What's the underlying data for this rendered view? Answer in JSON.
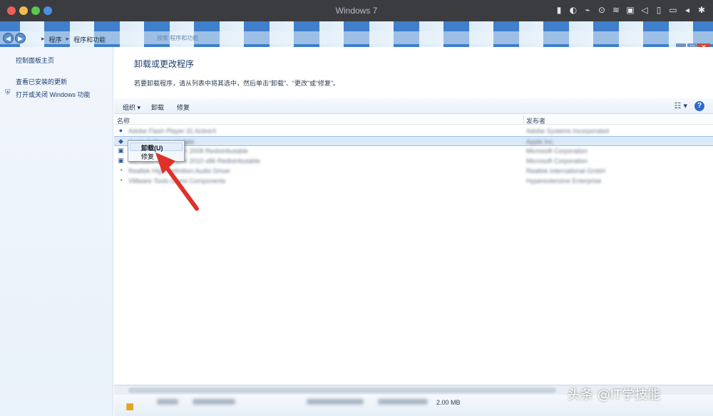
{
  "mac": {
    "title": "Windows 7",
    "status_icons": [
      "battery-icon",
      "moon-icon",
      "plug-icon",
      "search-icon",
      "wifi-icon",
      "image-icon",
      "volume-icon",
      "phone-icon",
      "display-icon",
      "play-left-icon",
      "gear-icon"
    ]
  },
  "address": {
    "crumbs": [
      "程序",
      "程序和功能"
    ],
    "search_placeholder": "搜索 程序和功能"
  },
  "left": {
    "links": [
      "控制面板主页",
      "查看已安装的更新",
      "打开或关闭 Windows 功能"
    ]
  },
  "main": {
    "title": "卸载或更改程序",
    "description": "若要卸载程序，请从列表中将其选中，然后单击“卸载”、“更改”或“修复”。"
  },
  "toolbar": {
    "organize": "组织 ▾",
    "uninstall": "卸载",
    "change": "修复",
    "view_glyph": "☷ ▾",
    "help_glyph": "?"
  },
  "columns": {
    "name": "名称",
    "publisher": "发布者"
  },
  "rows": [
    {
      "icon": "●",
      "name": "Adobe Flash Player 31 ActiveX",
      "publisher": "Adobe Systems Incorporated"
    },
    {
      "icon": "◆",
      "name": "Apple Software Update",
      "publisher": "Apple Inc."
    },
    {
      "icon": "▣",
      "name": "Microsoft Visual C++ 2008 Redistributable",
      "publisher": "Microsoft Corporation"
    },
    {
      "icon": "▣",
      "name": "Microsoft Visual C++ 2010 x86 Redistributable",
      "publisher": "Microsoft Corporation"
    },
    {
      "icon": "◔",
      "name": "Realtek High Definition Audio Driver",
      "publisher": "Realtek International GmbH"
    },
    {
      "icon": "◔",
      "name": "VMware Tools Guest Components",
      "publisher": "Hyperextensive Enterprise"
    }
  ],
  "context_menu": {
    "items": [
      "卸载(U)",
      "修复"
    ]
  },
  "details": {
    "size": "2.00 MB"
  },
  "watermark": "头条 @IT学技能"
}
